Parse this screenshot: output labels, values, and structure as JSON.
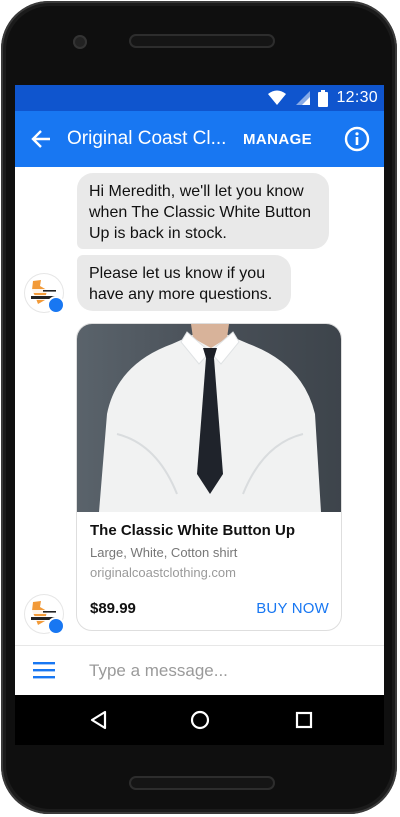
{
  "status": {
    "time": "12:30"
  },
  "appbar": {
    "title": "Original Coast Cl...",
    "manage_label": "MANAGE"
  },
  "messages": [
    {
      "text": "Hi Meredith, we'll let you know when The Classic White Button Up is back in stock."
    },
    {
      "text": "Please let us know if you have any more questions."
    }
  ],
  "avatar": {
    "brand_lines": [
      "ORIGINAL COAST",
      "CLOTHING"
    ]
  },
  "product": {
    "title": "The Classic White Button Up",
    "subtitle": "Large, White, Cotton shirt",
    "url": "originalcoastclothing.com",
    "price": "$89.99",
    "cta": "BUY NOW"
  },
  "composer": {
    "placeholder": "Type a message..."
  },
  "colors": {
    "primary": "#1877f2",
    "statusbar": "#0f55ce",
    "bubble": "#e9e9e9"
  },
  "icons": [
    "wifi-icon",
    "cell-signal-icon",
    "battery-icon",
    "back-arrow-icon",
    "info-icon",
    "menu-icon",
    "nav-back-icon",
    "nav-home-icon",
    "nav-recents-icon",
    "messenger-icon"
  ]
}
